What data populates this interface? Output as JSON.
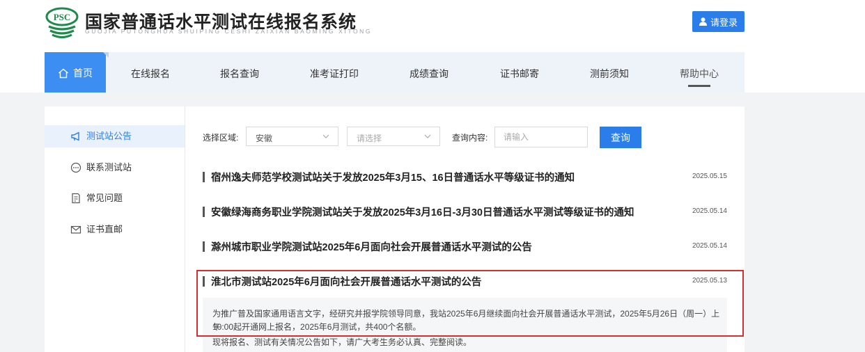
{
  "header": {
    "logo_text": "PSC",
    "site_title": "国家普通话水平测试在线报名系统",
    "site_subtitle": "GUOJIA PUTONGHUA SHUIPING CESHI ZAIXIAN BAOMING XITONG",
    "login_label": "请登录"
  },
  "nav": {
    "items": [
      {
        "label": "首页"
      },
      {
        "label": "在线报名"
      },
      {
        "label": "报名查询"
      },
      {
        "label": "准考证打印"
      },
      {
        "label": "成绩查询"
      },
      {
        "label": "证书邮寄"
      },
      {
        "label": "测前须知"
      },
      {
        "label": "帮助中心"
      }
    ]
  },
  "sidebar": {
    "items": [
      {
        "label": "测试站公告",
        "icon": "megaphone-icon"
      },
      {
        "label": "联系测试站",
        "icon": "chat-icon"
      },
      {
        "label": "常见问题",
        "icon": "document-icon"
      },
      {
        "label": "证书直邮",
        "icon": "mail-icon"
      }
    ]
  },
  "filters": {
    "region_label": "选择区域:",
    "province_value": "安徽",
    "city_placeholder": "请选择",
    "content_label": "查询内容:",
    "content_placeholder": "请输入",
    "query_label": "查询"
  },
  "notices": [
    {
      "title": "宿州逸夫师范学校测试站关于发放2025年3月15、16日普通话水平等级证书的通知",
      "date": "2025.05.15"
    },
    {
      "title": "安徽绿海商务职业学院测试站关于发放2025年3月16日-3月30日普通话水平测试等级证书的通知",
      "date": "2025.05.14"
    },
    {
      "title": "滁州城市职业学院测试站2025年6月面向社会开展普通话水平测试的公告",
      "date": "2025.05.14"
    },
    {
      "title": "淮北市测试站2025年6月面向社会开展普通话水平测试的公告",
      "date": "2025.05.13"
    }
  ],
  "summary": {
    "line1": "为推广普及国家通用语言文字，经研究并报学院领导同意，我站2025年6月继续面向社会开展普通话水平测试，2025年5月26日（周一）上午",
    "line2": "10:00起开通网上报名，2025年6月测试，共400个名额。",
    "line3": "现将报名、测试有关情况公告如下，请广大考生务必认真、完整阅读。"
  },
  "colors": {
    "accent": "#2b7de9",
    "nav_active": "#3d8ef2",
    "highlight_border": "#d32f2f"
  }
}
